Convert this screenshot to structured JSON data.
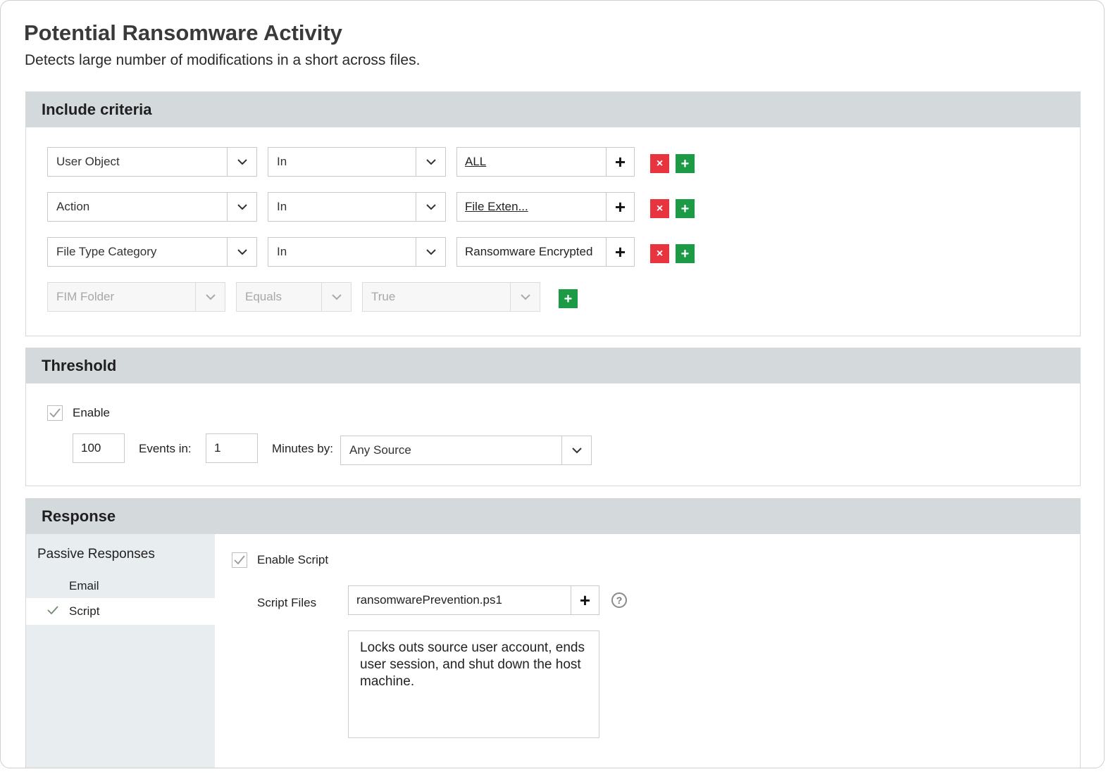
{
  "header": {
    "title": "Potential Ransomware Activity",
    "subtitle": "Detects large number of modifications in a short across files."
  },
  "include_criteria": {
    "title": "Include criteria",
    "rows": [
      {
        "field": "User Object",
        "operator": "In",
        "value": "ALL"
      },
      {
        "field": "Action",
        "operator": "In",
        "value": "File Exten..."
      },
      {
        "field": "File Type Category",
        "operator": "In",
        "value": "Ransomware Encrypted"
      }
    ],
    "disabled_row": {
      "field": "FIM Folder",
      "operator": "Equals",
      "value": "True"
    },
    "add_symbol": "+",
    "remove_symbol": "×"
  },
  "threshold": {
    "title": "Threshold",
    "enable_label": "Enable",
    "enabled": true,
    "count_value": "100",
    "events_in_label": "Events in:",
    "minutes_value": "1",
    "minutes_by_label": "Minutes by:",
    "source_value": "Any Source"
  },
  "response": {
    "title": "Response",
    "nav_heading": "Passive Responses",
    "nav_items": [
      {
        "label": "Email",
        "active": false
      },
      {
        "label": "Script",
        "active": true
      }
    ],
    "enable_script_label": "Enable Script",
    "script_enabled": true,
    "script_files_label": "Script Files",
    "script_file_value": "ransomwarePrevention.ps1",
    "help_symbol": "?",
    "description": "Locks outs source user account, ends user session, and shut down the host machine."
  },
  "icons": {
    "chevron": "chevron-down-icon",
    "check": "check-icon",
    "help": "help-circle-icon"
  }
}
